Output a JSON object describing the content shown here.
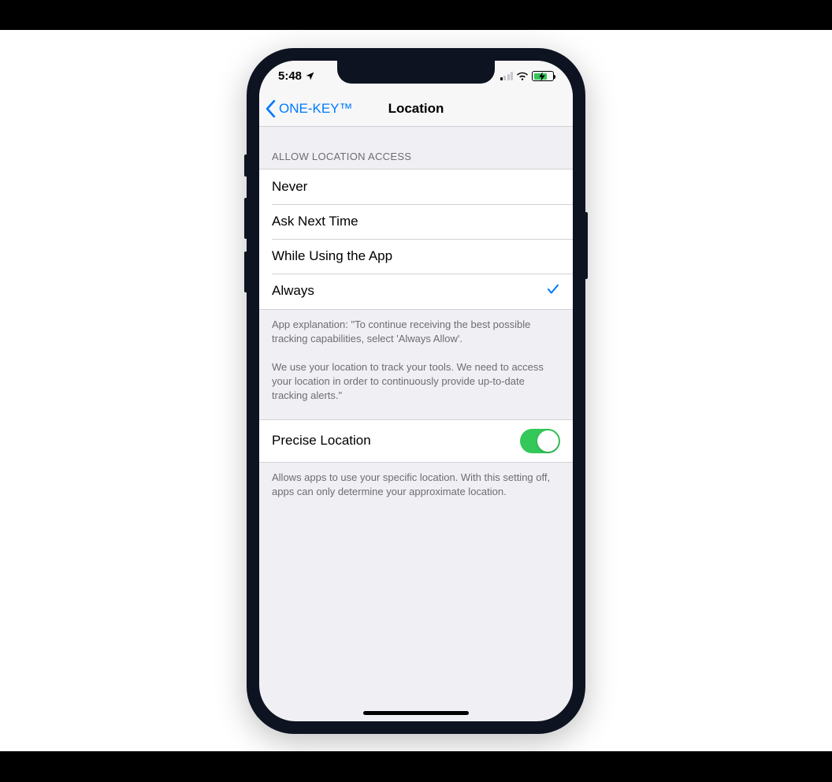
{
  "status_bar": {
    "time": "5:48",
    "location_arrow": "location-arrow",
    "signal_bars_active": 1,
    "wifi": "wifi",
    "battery_charging": true
  },
  "nav": {
    "back_label": "ONE-KEY™",
    "title": "Location"
  },
  "section_header": "ALLOW LOCATION ACCESS",
  "options": [
    {
      "label": "Never",
      "selected": false
    },
    {
      "label": "Ask Next Time",
      "selected": false
    },
    {
      "label": "While Using the App",
      "selected": false
    },
    {
      "label": "Always",
      "selected": true
    }
  ],
  "explanation": "App explanation: \"To continue receiving the best possible tracking capabilities, select 'Always Allow'.\n\nWe use your location to track your tools. We need to access your location in order to continuously provide up-to-date tracking alerts.\"",
  "precise": {
    "label": "Precise Location",
    "on": true
  },
  "precise_footer": "Allows apps to use your specific location. With this setting off, apps can only determine your approximate location."
}
